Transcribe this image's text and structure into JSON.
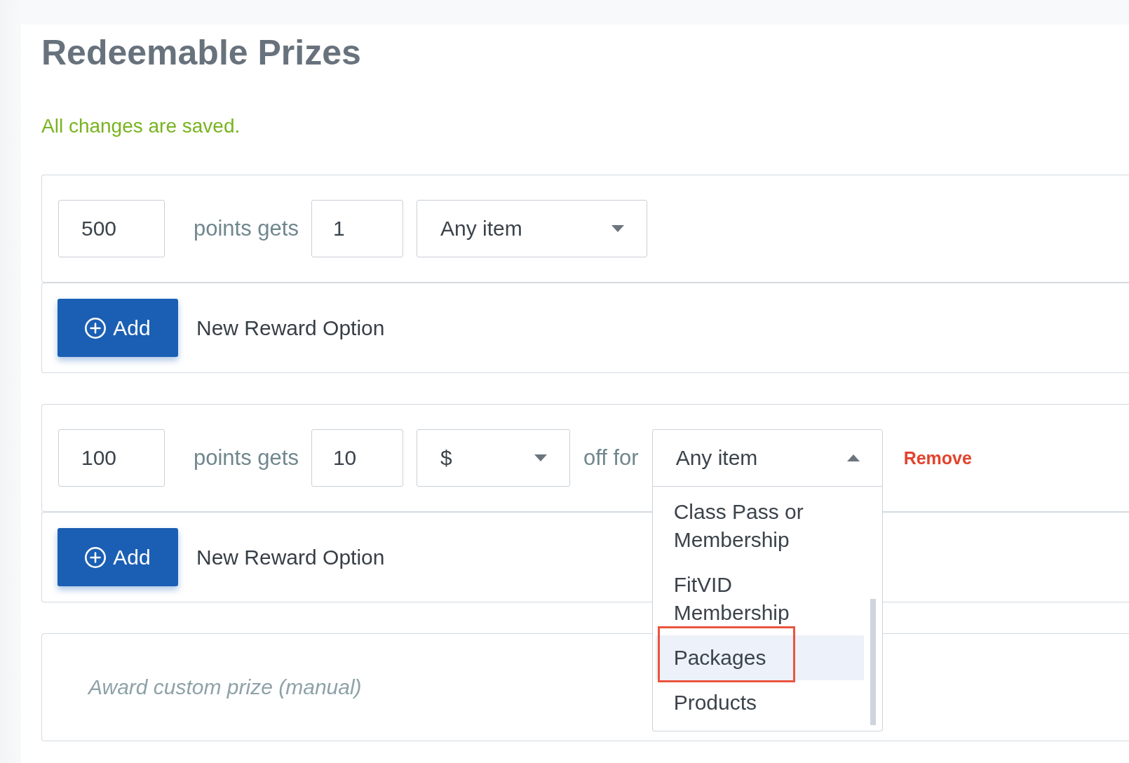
{
  "title": "Redeemable Prizes",
  "save_status": "All changes are saved.",
  "rewards": [
    {
      "kind": "item",
      "points": "500",
      "points_label": "points gets",
      "amount": "1",
      "item_select": {
        "value": "Any item",
        "expanded": false
      },
      "add_button": "Add",
      "add_label": "New Reward Option"
    },
    {
      "kind": "discount",
      "points": "100",
      "points_label": "points gets",
      "amount": "10",
      "unit_select": {
        "value": "$",
        "expanded": false
      },
      "for_label": "off for",
      "item_select": {
        "value": "Any item",
        "expanded": true,
        "options": [
          {
            "label": "Class Pass or Membership",
            "selected": false,
            "outlined": false
          },
          {
            "label": "FitVID Membership",
            "selected": false,
            "outlined": false
          },
          {
            "label": "Packages",
            "selected": true,
            "outlined": true
          },
          {
            "label": "Products",
            "selected": false,
            "outlined": false
          }
        ]
      },
      "remove": "Remove",
      "add_button": "Add",
      "add_label": "New Reward Option"
    }
  ],
  "custom_prize": {
    "placeholder": "Award custom prize (manual)"
  }
}
